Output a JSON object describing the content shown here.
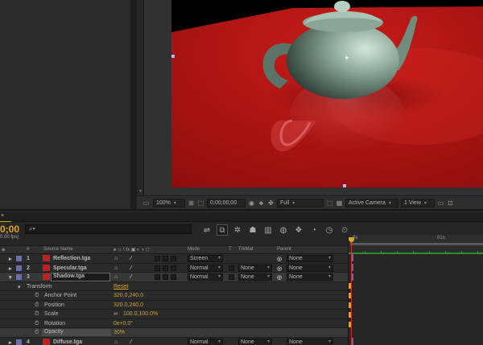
{
  "viewer": {
    "zoom": "100%",
    "timecode": "0;00;00;00",
    "resolution": "Full",
    "camera": "Active Camera",
    "view_layout": "1 View"
  },
  "timeline": {
    "tab_close": "×",
    "timecode": "0;00",
    "fps": "0.00 fps)",
    "search_placeholder": "",
    "columns": {
      "label_icon": "◈",
      "number": "#",
      "source_name": "Source Name",
      "switches": "♠ ☼ \\ fx ▣ ◐ ◑ ⬡",
      "mode": "Mode",
      "t": "T",
      "trkmat": "TrkMat",
      "parent": "Parent"
    },
    "ruler": {
      "start": "0s",
      "mark": "01s"
    },
    "layers": [
      {
        "number": "1",
        "name": "Reflection.tga",
        "mode": "Screen",
        "trkmat": "",
        "parent": "None"
      },
      {
        "number": "2",
        "name": "Specular.tga",
        "mode": "Normal",
        "trkmat": "None",
        "parent": "None"
      },
      {
        "number": "3",
        "name": "Shadow.tga",
        "mode": "Normal",
        "trkmat": "None",
        "parent": "None"
      }
    ],
    "transform": {
      "label": "Transform",
      "reset": "Reset",
      "properties": [
        {
          "name": "Anchor Point",
          "value": "320.0,240.0"
        },
        {
          "name": "Position",
          "value": "320.0,240.0"
        },
        {
          "name": "Scale",
          "value": "100.0,100.0%"
        },
        {
          "name": "Rotation",
          "value": "0x+0.0°"
        },
        {
          "name": "Opacity",
          "value": "30%"
        }
      ]
    },
    "layer4": {
      "number": "4",
      "name": "Diffuse.tga",
      "mode": "Normal",
      "trkmat": "None",
      "parent": "None"
    }
  },
  "colors": {
    "accent": "#e0a617",
    "surface": "#c01a17",
    "teapot": "#7a9a8a",
    "layer_bar": "#8a8abd"
  },
  "icons": [
    "search-icon",
    "snapshot-icon",
    "channel-icon",
    "region-icon",
    "grid-icon",
    "draft-3d-icon",
    "motion-blur-icon",
    "graph-editor-icon",
    "keyframe-icon"
  ]
}
